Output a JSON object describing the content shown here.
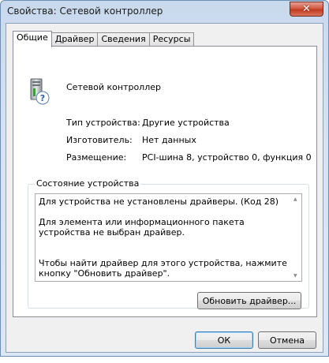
{
  "window": {
    "title": "Свойства: Сетевой контроллер",
    "close_symbol": "✕"
  },
  "tabs": [
    {
      "label": "Общие",
      "active": true
    },
    {
      "label": "Драйвер",
      "active": false
    },
    {
      "label": "Сведения",
      "active": false
    },
    {
      "label": "Ресурсы",
      "active": false
    }
  ],
  "device": {
    "icon": "unknown-device-icon",
    "name": "Сетевой контроллер",
    "properties": [
      {
        "label": "Тип устройства:",
        "value": "Другие устройства"
      },
      {
        "label": "Изготовитель:",
        "value": "Нет данных"
      },
      {
        "label": "Размещение:",
        "value": "PCI-шина 8, устройство 0, функция 0"
      }
    ]
  },
  "status": {
    "group_title": "Состояние устройства",
    "lines": [
      "Для устройства не установлены драйверы. (Код 28)",
      "",
      "Для элемента или информационного пакета устройства не выбран драйвер.",
      "",
      "",
      "Чтобы найти драйвер для этого устройства, нажмите кнопку \"Обновить драйвер\"."
    ],
    "update_button": "Обновить драйвер..."
  },
  "buttons": {
    "ok": "ОК",
    "cancel": "Отмена"
  },
  "colors": {
    "title_bar": "#c9d9ed",
    "close_button": "#c0391f",
    "dialog_bg": "#f0f0f0"
  }
}
